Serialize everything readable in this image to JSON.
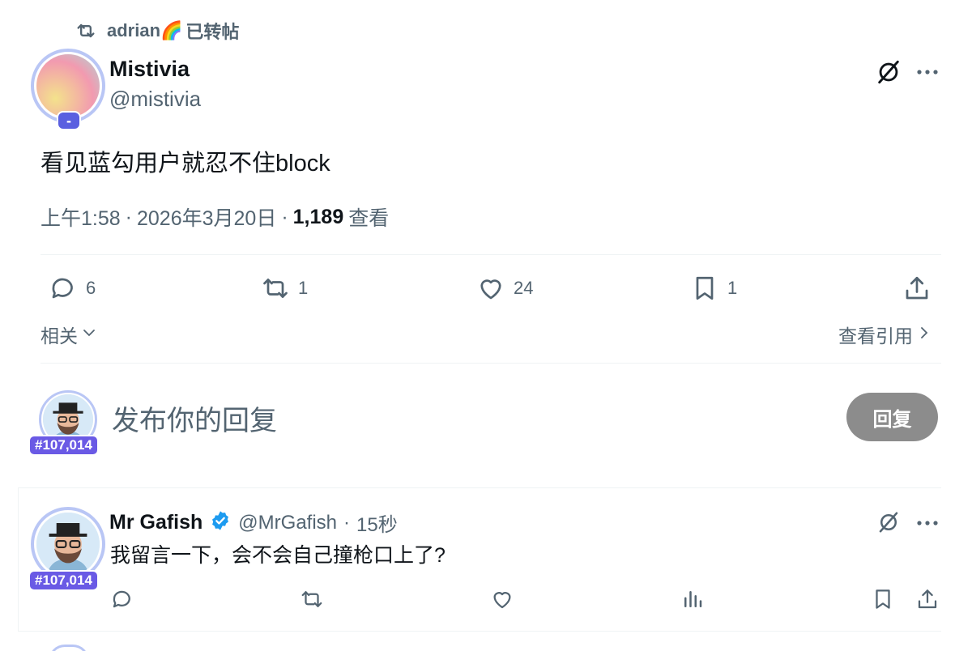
{
  "repost_banner": {
    "user": "adrian🌈",
    "action_text": "已转帖"
  },
  "post": {
    "author_name": "Mistivia",
    "author_handle": "@mistivia",
    "avatar_badge": "-",
    "text": "看见蓝勾用户就忍不住block",
    "time": "上午1:58",
    "date": "2026年3月20日",
    "views_count": "1,189",
    "views_label": "查看",
    "stats": {
      "replies": "6",
      "reposts": "1",
      "likes": "24",
      "bookmarks": "1"
    },
    "related_label": "相关",
    "view_quotes_label": "查看引用"
  },
  "composer": {
    "placeholder": "发布你的回复",
    "button_label": "回复",
    "user_tag": "#107,014"
  },
  "comment": {
    "author_name": "Mr Gafish",
    "author_handle": "@MrGafish",
    "time_ago": "15秒",
    "text": "我留言一下，会不会自己撞枪口上了?",
    "user_tag": "#107,014"
  },
  "colors": {
    "accent": "#1d9bf0",
    "muted": "#536471",
    "tag": "#6a5ae5",
    "reply_button": "#8c8c8c"
  },
  "icons": [
    "repost-icon",
    "grok-slash-icon",
    "more-icon",
    "reply-icon",
    "like-icon",
    "bookmark-icon",
    "share-icon",
    "views-chart-icon",
    "verified-icon"
  ]
}
